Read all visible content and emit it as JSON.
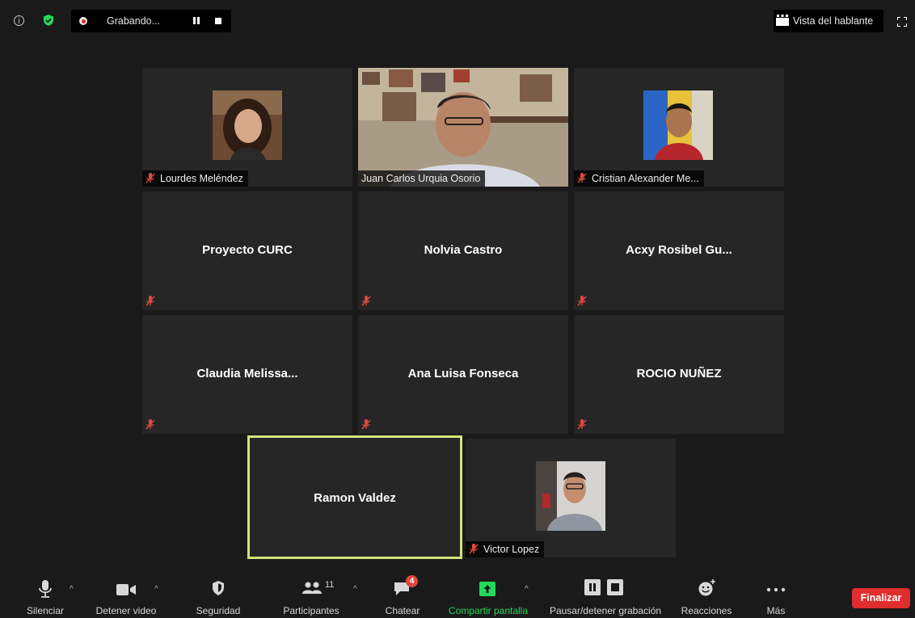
{
  "topbar": {
    "recording_label": "Grabando...",
    "speaker_view_label": "Vista del hablante"
  },
  "participants": [
    {
      "name": "Lourdes Meléndez",
      "video": true,
      "muted": true
    },
    {
      "name": "Juan Carlos Urquia Osorio",
      "video": true,
      "muted": false
    },
    {
      "name": "Cristian Alexander Me...",
      "video": true,
      "muted": true
    },
    {
      "name": "Proyecto CURC",
      "video": false,
      "muted": true
    },
    {
      "name": "Nolvia Castro",
      "video": false,
      "muted": true
    },
    {
      "name": "Acxy Rosibel Gu...",
      "video": false,
      "muted": true
    },
    {
      "name": "Claudia Melissa...",
      "video": false,
      "muted": true
    },
    {
      "name": "Ana Luisa Fonseca",
      "video": false,
      "muted": true
    },
    {
      "name": "ROCIO NUÑEZ",
      "video": false,
      "muted": true
    },
    {
      "name": "Ramon Valdez",
      "video": false,
      "muted": false,
      "active_speaker": true
    },
    {
      "name": "Victor Lopez",
      "video": true,
      "muted": true
    }
  ],
  "toolbar": {
    "mute_label": "Silenciar",
    "video_label": "Detener video",
    "security_label": "Seguridad",
    "participants_label": "Participantes",
    "participants_count": "11",
    "chat_label": "Chatear",
    "chat_badge": "4",
    "share_label": "Compartir pantalla",
    "record_label": "Pausar/detener grabación",
    "reactions_label": "Reacciones",
    "more_label": "Más",
    "end_label": "Finalizar"
  },
  "colors": {
    "background": "#1a1a1a",
    "tile": "#262626",
    "active_speaker_border": "#d4e47a",
    "share_green": "#23d959",
    "end_red": "#e02d2d",
    "muted_red": "#e0483d"
  }
}
